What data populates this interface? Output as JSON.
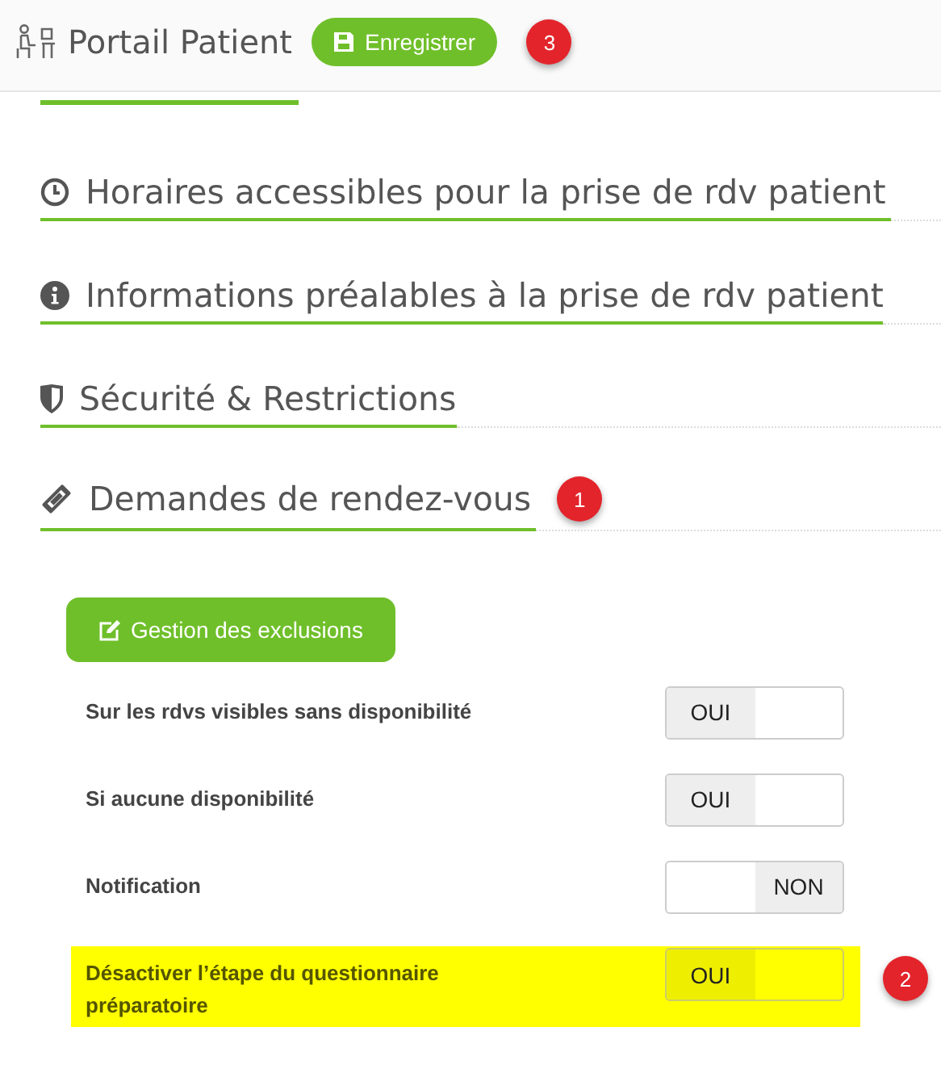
{
  "header": {
    "title": "Portail Patient",
    "save_button": "Enregistrer",
    "badge": "3"
  },
  "sections": [
    {
      "kind": "clock",
      "title": "Horaires accessibles pour la prise de rdv patient"
    },
    {
      "kind": "info",
      "title": "Informations préalables à la prise de rdv patient"
    },
    {
      "kind": "shield",
      "title": "Sécurité & Restrictions"
    },
    {
      "kind": "ticket",
      "title": "Demandes de rendez-vous",
      "badge": "1"
    }
  ],
  "exclusions_button": "Gestion des exclusions",
  "settings": [
    {
      "label": "Sur les rdvs visibles sans disponibilité",
      "on": true,
      "value": "OUI",
      "highlighted": false
    },
    {
      "label": "Si aucune disponibilité",
      "on": true,
      "value": "OUI",
      "highlighted": false
    },
    {
      "label": "Notification",
      "on": false,
      "value": "NON",
      "highlighted": false
    },
    {
      "label": "Désactiver l’étape du questionnaire préparatoire",
      "on": true,
      "value": "OUI",
      "highlighted": true,
      "badge": "2"
    }
  ]
}
